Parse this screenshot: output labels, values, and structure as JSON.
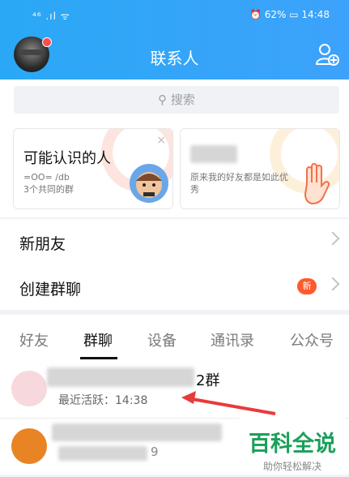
{
  "status": {
    "left": "⁴⁶ .ıl ᯤ",
    "right": "⏰ 62% ▭ 14:48"
  },
  "header": {
    "title": "联系人"
  },
  "search": {
    "placeholder": "搜索"
  },
  "cards": [
    {
      "title": "可能认识的人",
      "sub1": "=OO= /db",
      "sub2": "3个共同的群",
      "close": "×"
    },
    {
      "sub": "原来我的好友都是如此优秀"
    }
  ],
  "rows": [
    {
      "label": "新朋友"
    },
    {
      "label": "创建群聊",
      "badge": "新"
    }
  ],
  "tabs": [
    "好友",
    "群聊",
    "设备",
    "通讯录",
    "公众号"
  ],
  "list": [
    {
      "title_suffix": "2群",
      "sub": "最近活跃：14:38"
    },
    {
      "title_suffix": "9"
    }
  ],
  "watermark": {
    "big": "百科全说",
    "small": "助你轻松解决"
  },
  "colors": {
    "header": "#2aa8f5",
    "badge": "#ff5a2d",
    "watermark": "#1aa05a"
  }
}
